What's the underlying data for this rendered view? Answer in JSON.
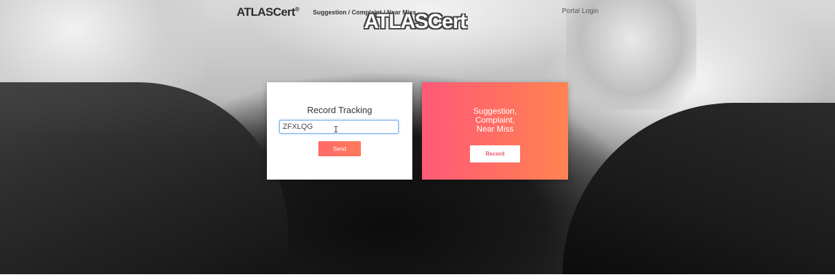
{
  "header": {
    "brand_small": "ATLASCert",
    "brand_small_mark": "®",
    "nav_link": "Suggestion / Complaint / Near Miss",
    "portal_login": "Portal Login",
    "brand_large": "ATLASCert"
  },
  "tracking_card": {
    "title": "Record Tracking",
    "input_value": "ZFXLQG",
    "send_label": "Send"
  },
  "record_card": {
    "heading_line1": "Suggestion,",
    "heading_line2": "Complaint,",
    "heading_line3": "Near Miss",
    "record_label": "Record"
  },
  "colors": {
    "accent_start": "#ff5a78",
    "accent_end": "#ff8452",
    "input_focus": "#7fb0e6"
  },
  "icons": [
    "text-cursor-icon"
  ]
}
